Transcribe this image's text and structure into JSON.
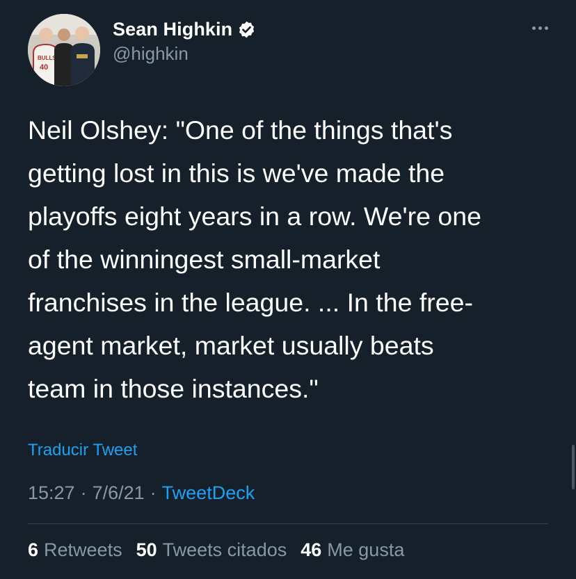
{
  "author": {
    "display_name": "Sean Highkin",
    "handle": "@highkin",
    "verified": true,
    "avatar_jersey_text": "BULLS 40"
  },
  "tweet": {
    "text": "Neil Olshey: \"One of the things that's\ngetting lost in this is we've made the\nplayoffs eight years in a row. We're one\nof the winningest small-market\nfranchises in the league. ... In the free-\nagent market, market usually beats\nteam in those instances.\"",
    "translate_label": "Traducir Tweet",
    "time": "15:27",
    "date": "7/6/21",
    "separator": "·",
    "source": "TweetDeck"
  },
  "stats": {
    "retweets_count": "6",
    "retweets_label": "Retweets",
    "quotes_count": "50",
    "quotes_label": "Tweets citados",
    "likes_count": "46",
    "likes_label": "Me gusta"
  },
  "icons": {
    "verified": "verified-badge-icon",
    "more": "more-options-icon"
  },
  "colors": {
    "background": "#15202b",
    "accent": "#1da1f2",
    "secondary_text": "#8899a6",
    "divider": "#38444d"
  }
}
